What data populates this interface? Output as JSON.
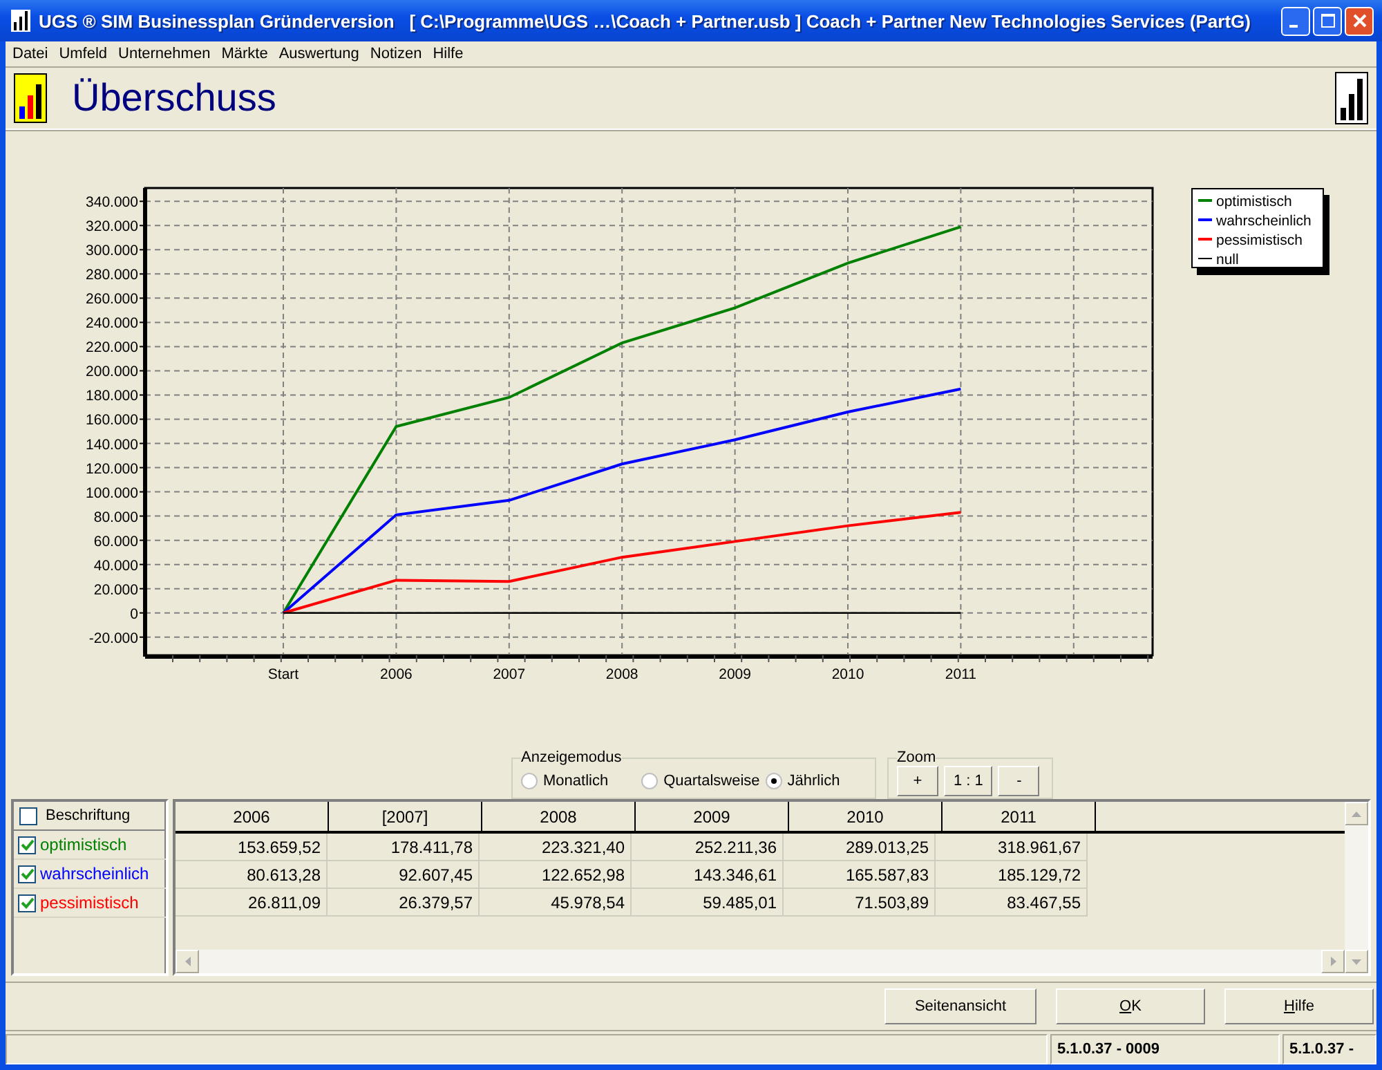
{
  "window": {
    "title": "UGS ® SIM Businessplan Gründerversion   [ C:\\Programme\\UGS …\\Coach + Partner.usb ] Coach + Partner New Technologies Services (PartG)"
  },
  "menu": [
    "Datei",
    "Umfeld",
    "Unternehmen",
    "Märkte",
    "Auswertung",
    "Notizen",
    "Hilfe"
  ],
  "page_title": "Überschuss",
  "chart_data": {
    "type": "line",
    "grid": true,
    "legend": "right",
    "categories": [
      "Start",
      "2006",
      "2007",
      "2008",
      "2009",
      "2010",
      "2011"
    ],
    "ylim": [
      -35000,
      351000
    ],
    "yticks": [
      {
        "value": 340000,
        "label": "340.000"
      },
      {
        "value": 320000,
        "label": "320.000"
      },
      {
        "value": 300000,
        "label": "300.000"
      },
      {
        "value": 280000,
        "label": "280.000"
      },
      {
        "value": 260000,
        "label": "260.000"
      },
      {
        "value": 240000,
        "label": "240.000"
      },
      {
        "value": 220000,
        "label": "220.000"
      },
      {
        "value": 200000,
        "label": "200.000"
      },
      {
        "value": 180000,
        "label": "180.000"
      },
      {
        "value": 160000,
        "label": "160.000"
      },
      {
        "value": 140000,
        "label": "140.000"
      },
      {
        "value": 120000,
        "label": "120.000"
      },
      {
        "value": 100000,
        "label": "100.000"
      },
      {
        "value": 80000,
        "label": "80.000"
      },
      {
        "value": 60000,
        "label": "60.000"
      },
      {
        "value": 40000,
        "label": "40.000"
      },
      {
        "value": 20000,
        "label": "20.000"
      },
      {
        "value": 0,
        "label": "0"
      },
      {
        "value": -20000,
        "label": "-20.000"
      }
    ],
    "series": [
      {
        "name": "optimistisch",
        "color": "#008000",
        "values": [
          0,
          154000,
          178000,
          223000,
          252000,
          289000,
          319000
        ]
      },
      {
        "name": "wahrscheinlich",
        "color": "#0000ff",
        "values": [
          0,
          81000,
          93000,
          123000,
          143000,
          166000,
          185000
        ]
      },
      {
        "name": "pessimistisch",
        "color": "#ff0000",
        "values": [
          0,
          27000,
          26000,
          46000,
          59000,
          72000,
          83000
        ]
      },
      {
        "name": "null",
        "color": "#000000",
        "values": [
          0,
          0,
          0,
          0,
          0,
          0,
          0
        ]
      }
    ]
  },
  "display_mode": {
    "label": "Anzeigemodus",
    "options": [
      {
        "label": "Monatlich",
        "selected": false
      },
      {
        "label": "Quartalsweise",
        "selected": false
      },
      {
        "label": "Jährlich",
        "selected": true
      }
    ]
  },
  "zoom": {
    "label": "Zoom",
    "buttons": [
      "+",
      "1 : 1",
      "-"
    ]
  },
  "table": {
    "label_toggle": {
      "label": "Beschriftung",
      "checked": false
    },
    "columns": [
      "2006",
      "[2007]",
      "2008",
      "2009",
      "2010",
      "2011"
    ],
    "rows": [
      {
        "name": "optimistisch",
        "checked": true,
        "color": "#008000",
        "cells": [
          "153.659,52",
          "178.411,78",
          "223.321,40",
          "252.211,36",
          "289.013,25",
          "318.961,67"
        ]
      },
      {
        "name": "wahrscheinlich",
        "checked": true,
        "color": "#0000ff",
        "cells": [
          "80.613,28",
          "92.607,45",
          "122.652,98",
          "143.346,61",
          "165.587,83",
          "185.129,72"
        ]
      },
      {
        "name": "pessimistisch",
        "checked": true,
        "color": "#ff0000",
        "cells": [
          "26.811,09",
          "26.379,57",
          "45.978,54",
          "59.485,01",
          "71.503,89",
          "83.467,55"
        ]
      }
    ]
  },
  "buttons": [
    {
      "kind": "plain",
      "label": "Seitenansicht"
    },
    {
      "kind": "access",
      "key": "O",
      "rest": "K"
    },
    {
      "kind": "access",
      "key": "H",
      "rest": "ilfe"
    }
  ],
  "status_bar": [
    "5.1.0.37 - 0009",
    "5.1.0.37 -"
  ]
}
